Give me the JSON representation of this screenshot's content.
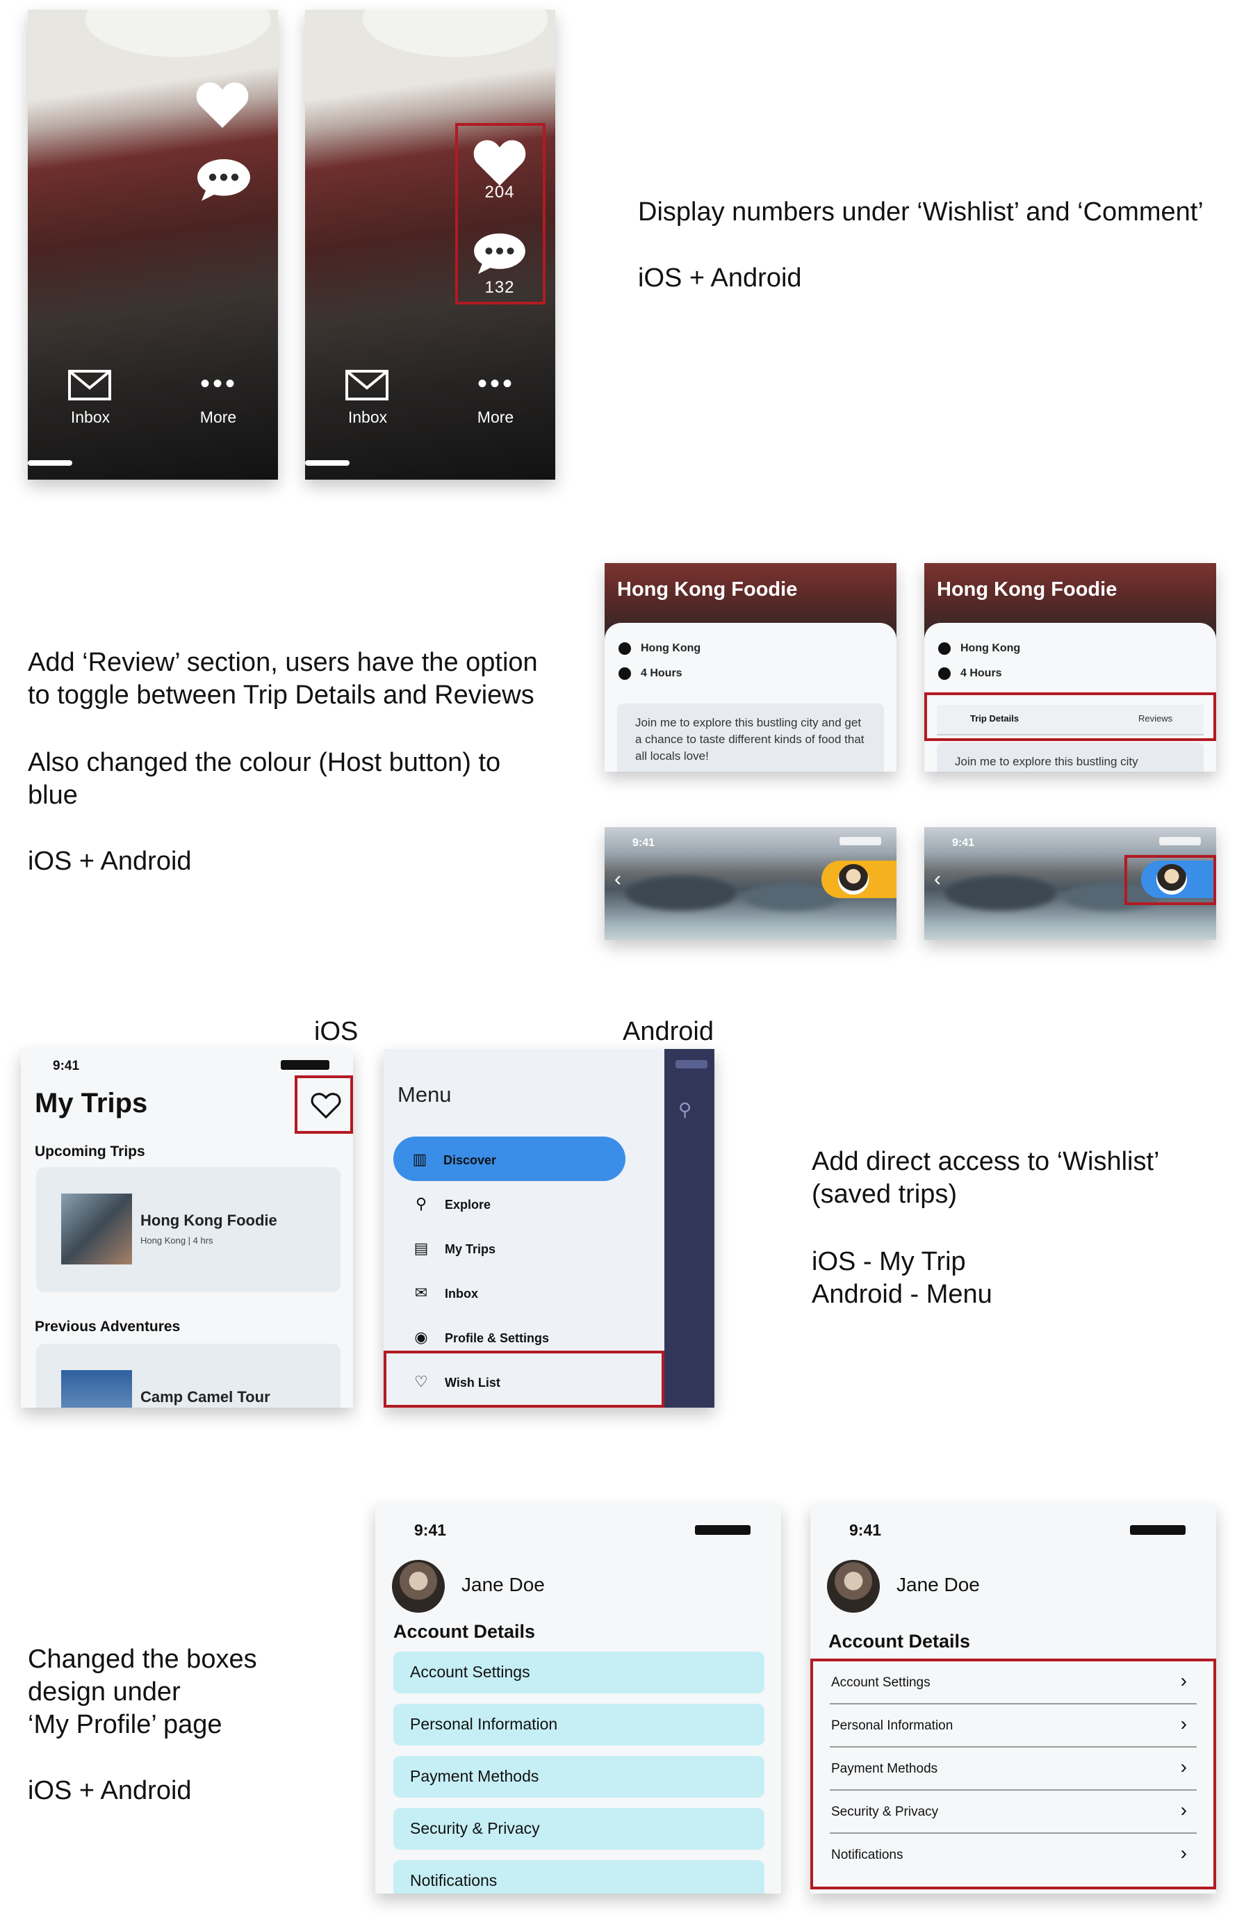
{
  "section1": {
    "phone_before": {
      "tabs": [
        "Inbox",
        "More"
      ]
    },
    "phone_after": {
      "wishlist_count": "204",
      "comment_count": "132",
      "tabs": [
        "Inbox",
        "More"
      ]
    },
    "note_line1": "Display numbers under ‘Wishlist’ and ‘Comment’",
    "note_line2": "iOS + Android"
  },
  "section2": {
    "note_p1": "Add ‘Review’ section, users have the option\nto toggle between Trip Details and Reviews",
    "note_p2": "Also changed the colour (Host button) to\nblue",
    "note_p3": "iOS + Android",
    "card_before": {
      "title": "Hong Kong Foodie",
      "location": "Hong Kong",
      "duration": "4 Hours",
      "description": "Join me to explore this bustling city and get a chance to taste different kinds of food that all locals love!"
    },
    "card_after": {
      "title": "Hong Kong Foodie",
      "location": "Hong Kong",
      "duration": "4 Hours",
      "tab_details": "Trip Details",
      "tab_reviews": "Reviews",
      "description": "Join me to explore this bustling city"
    },
    "banner_time": "9:41",
    "host_button_before_color": "#f5b21e",
    "host_button_after_color": "#3a8ee8"
  },
  "section3": {
    "label_ios": "iOS",
    "label_android": "Android",
    "mytrips": {
      "time": "9:41",
      "title": "My Trips",
      "upcoming_heading": "Upcoming Trips",
      "trip1_name": "Hong Kong Foodie",
      "trip1_meta": "Hong Kong | 4 hrs",
      "previous_heading": "Previous Adventures",
      "trip2_name": "Camp Camel Tour"
    },
    "menu": {
      "title": "Menu",
      "items": [
        "Discover",
        "Explore",
        "My Trips",
        "Inbox",
        "Profile & Settings",
        "Wish List"
      ],
      "active_color": "#3a8ee8"
    },
    "note_p1": "Add direct access to ‘Wishlist’\n(saved trips)",
    "note_p2": "iOS - My Trip\nAndroid - Menu"
  },
  "section4": {
    "note_p1": "Changed the boxes\ndesign under\n‘My Profile’ page",
    "note_p2": "iOS + Android",
    "profile_before": {
      "time": "9:41",
      "name": "Jane Doe",
      "heading": "Account Details",
      "items": [
        "Account Settings",
        "Personal Information",
        "Payment Methods",
        "Security & Privacy",
        "Notifications"
      ]
    },
    "profile_after": {
      "time": "9:41",
      "name": "Jane Doe",
      "heading": "Account Details",
      "items": [
        "Account Settings",
        "Personal Information",
        "Payment Methods",
        "Security & Privacy",
        "Notifications"
      ]
    }
  },
  "colors": {
    "highlight": "#b21a24",
    "cyan_box": "#c6eff5",
    "accent_blue": "#3a8ee8"
  }
}
